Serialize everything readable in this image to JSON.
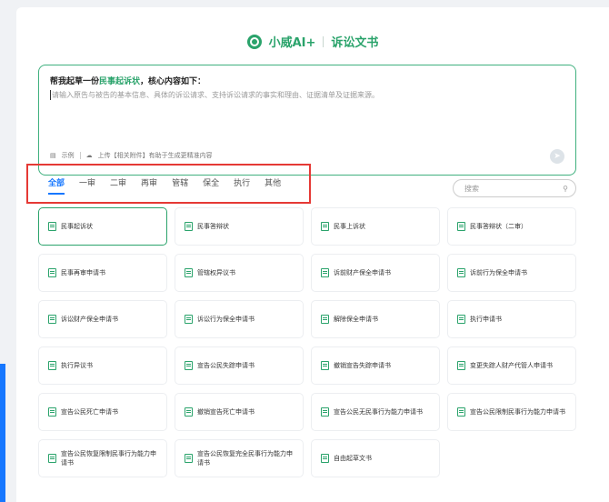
{
  "brand": {
    "name": "小威AI+",
    "product": "诉讼文书"
  },
  "prompt": {
    "title_prefix": "帮我起草一份",
    "title_highlight": "民事起诉状",
    "title_suffix": "，核心内容如下：",
    "placeholder": "请输入原告与被告的基本信息、具体的诉讼请求、支持诉讼请求的事实和理由、证据清单及证据来源。",
    "footer_example": "示例",
    "footer_upload": "上传【相关附件】有助于生成更精准内容"
  },
  "tabs": [
    {
      "label": "全部",
      "active": true
    },
    {
      "label": "一审"
    },
    {
      "label": "二审"
    },
    {
      "label": "再审"
    },
    {
      "label": "管辖"
    },
    {
      "label": "保全"
    },
    {
      "label": "执行"
    },
    {
      "label": "其他"
    }
  ],
  "search": {
    "placeholder": "搜索"
  },
  "documents": [
    "民事起诉状",
    "民事答辩状",
    "民事上诉状",
    "民事答辩状（二审）",
    "民事再审申请书",
    "管辖权异议书",
    "诉前财产保全申请书",
    "诉前行为保全申请书",
    "诉讼财产保全申请书",
    "诉讼行为保全申请书",
    "解除保全申请书",
    "执行申请书",
    "执行异议书",
    "宣告公民失踪申请书",
    "撤销宣告失踪申请书",
    "变更失踪人财产代管人申请书",
    "宣告公民死亡申请书",
    "撤销宣告死亡申请书",
    "宣告公民无民事行为能力申请书",
    "宣告公民限制民事行为能力申请书",
    "宣告公民恢复限制民事行为能力申请书",
    "宣告公民恢复完全民事行为能力申请书",
    "自由起草文书"
  ],
  "colors": {
    "accent": "#2aa36b",
    "active_tab": "#1677ff",
    "highlight_border": "#e53935"
  }
}
